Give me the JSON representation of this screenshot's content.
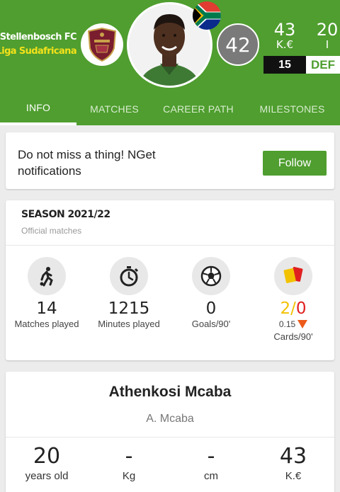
{
  "header": {
    "club": "Stellenbosch FC",
    "league": "Liga Sudafricana",
    "rating": "42",
    "value": "43",
    "value_unit": "K.€",
    "age": "20",
    "age_unit": "I",
    "number": "15",
    "position": "DEF",
    "colors": {
      "brand_green": "#4f9e2f",
      "league_yellow": "#f4e21a"
    }
  },
  "tabs": [
    {
      "label": "INFO",
      "active": true
    },
    {
      "label": "MATCHES",
      "active": false
    },
    {
      "label": "CAREER PATH",
      "active": false
    },
    {
      "label": "MILESTONES",
      "active": false
    }
  ],
  "follow": {
    "text": "Do not miss a thing!  NGet notifications",
    "button": "Follow"
  },
  "season": {
    "title": "SEASON 2021/22",
    "subtitle": "Official matches",
    "stats": [
      {
        "icon": "player-running-icon",
        "value": "14",
        "label": "Matches played"
      },
      {
        "icon": "stopwatch-icon",
        "value": "1215",
        "label": "Minutes played"
      },
      {
        "icon": "soccer-ball-icon",
        "value": "0",
        "label": "Goals/90'"
      }
    ],
    "cards": {
      "icon": "cards-icon",
      "yellow": "2",
      "separator": "/",
      "red": "0",
      "ratio": "0.15",
      "label": "Cards/90'"
    }
  },
  "bio": {
    "name": "Athenkosi Mcaba",
    "short_name": "A. Mcaba",
    "stats": [
      {
        "value": "20",
        "label": "years old"
      },
      {
        "value": "-",
        "label": "Kg"
      },
      {
        "value": "-",
        "label": "cm"
      },
      {
        "value": "43",
        "label": "K.€"
      }
    ]
  }
}
